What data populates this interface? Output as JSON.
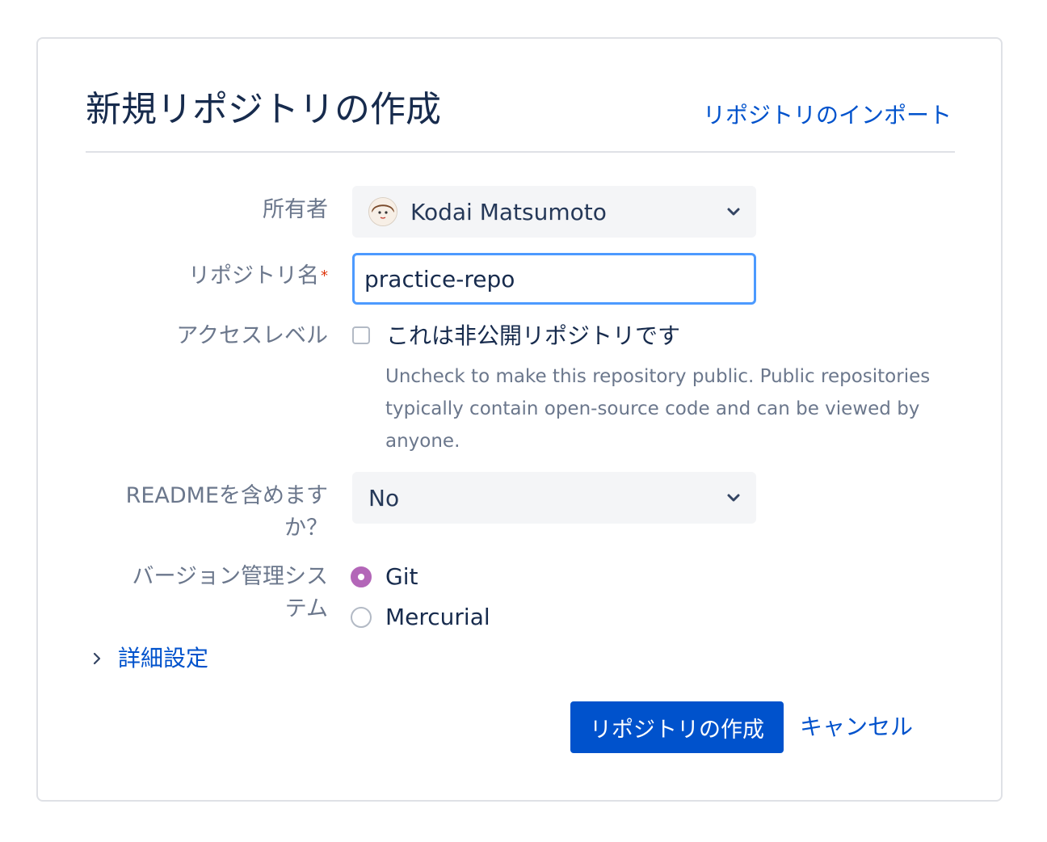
{
  "header": {
    "title": "新規リポジトリの作成",
    "import_link": "リポジトリのインポート"
  },
  "form": {
    "owner": {
      "label": "所有者",
      "value": "Kodai Matsumoto",
      "icon": "chevron-down-icon"
    },
    "repo_name": {
      "label": "リポジトリ名",
      "required_mark": "*",
      "value": "practice-repo"
    },
    "access": {
      "label": "アクセスレベル",
      "checkbox_label": "これは非公開リポジトリです",
      "checked": false,
      "help": "Uncheck to make this repository public. Public repositories typically contain open-source code and can be viewed by anyone."
    },
    "readme": {
      "label_line1": "READMEを含めます",
      "label_line2": "か？",
      "value": "No"
    },
    "vcs": {
      "label_line1": "バージョン管理シス",
      "label_line2": "テム",
      "options": [
        {
          "label": "Git",
          "selected": true
        },
        {
          "label": "Mercurial",
          "selected": false
        }
      ],
      "accent": "#b366b8"
    },
    "advanced_label": "詳細設定"
  },
  "actions": {
    "create_label": "リポジトリの作成",
    "cancel_label": "キャンセル"
  },
  "colors": {
    "primary": "#0052cc",
    "focus_border": "#4c9aff"
  }
}
